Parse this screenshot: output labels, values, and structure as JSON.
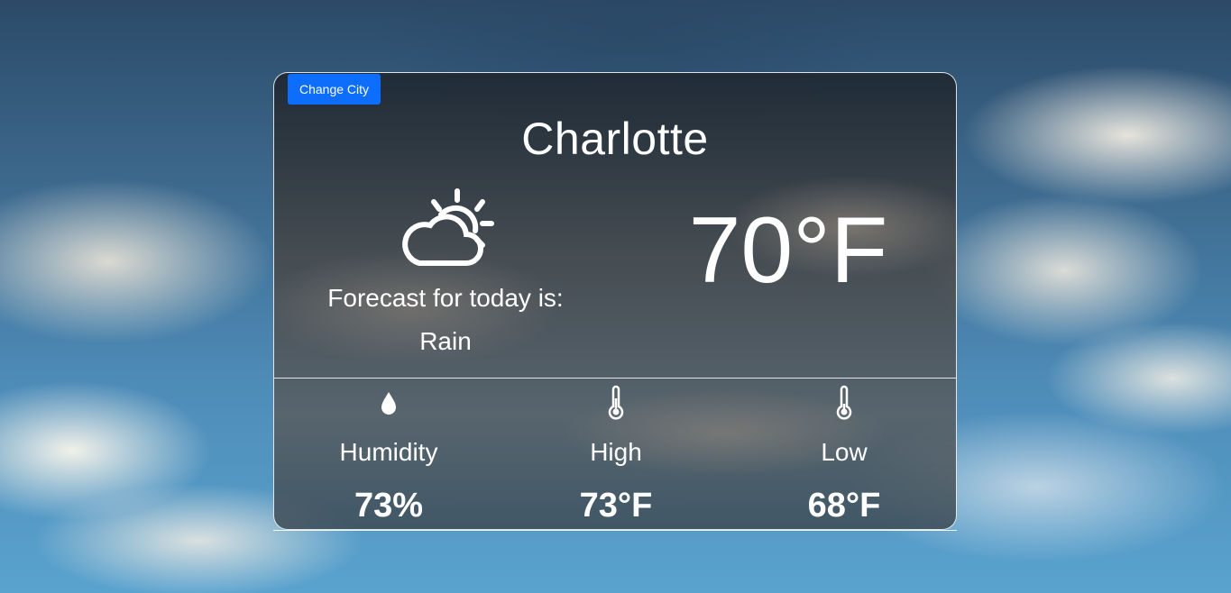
{
  "header": {
    "change_city_label": "Change City"
  },
  "current": {
    "city": "Charlotte",
    "icon": "partly-cloudy-icon",
    "forecast_label": "Forecast for today is:",
    "condition": "Rain",
    "temperature": "70°F"
  },
  "stats": [
    {
      "icon": "water-drop-icon",
      "label": "Humidity",
      "value": "73%"
    },
    {
      "icon": "thermometer-icon",
      "label": "High",
      "value": "73°F"
    },
    {
      "icon": "thermometer-icon",
      "label": "Low",
      "value": "68°F"
    }
  ],
  "colors": {
    "button": "#0d6efd",
    "text": "#ffffff"
  }
}
